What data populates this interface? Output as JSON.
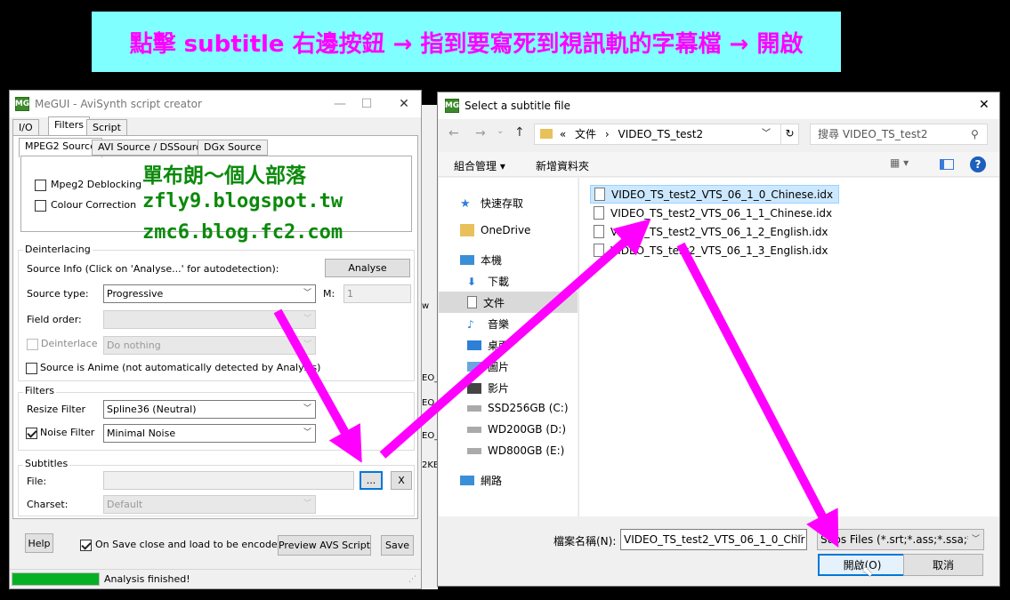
{
  "banner": {
    "text": "點擊 subtitle 右邊按鈕 → 指到要寫死到視訊軌的字幕檔 → 開啟"
  },
  "megui": {
    "title": "MeGUI - AviSynth script creator",
    "app_icon": "MG",
    "main_tabs": [
      "I/O",
      "Filters",
      "Script"
    ],
    "sub_tabs": [
      "MPEG2 Source",
      "AVI Source / DSSource",
      "DGx Source"
    ],
    "mpeg2": {
      "deblocking": "Mpeg2 Deblocking",
      "colour_correction": "Colour Correction"
    },
    "deinterlacing": {
      "legend": "Deinterlacing",
      "source_info": "Source Info (Click on 'Analyse...' for autodetection):",
      "analyse_button": "Analyse",
      "source_type_label": "Source type:",
      "source_type_value": "Progressive",
      "m_label": "M:",
      "m_value": "1",
      "field_order_label": "Field order:",
      "field_order_value": "",
      "deinterlace_label": "Deinterlace",
      "deinterlace_value": "Do nothing",
      "source_anime": "Source is Anime (not automatically detected by Analysis)"
    },
    "filters": {
      "legend": "Filters",
      "resize_label": "Resize Filter",
      "resize_value": "Spline36 (Neutral)",
      "noise_label": "Noise Filter",
      "noise_value": "Minimal Noise"
    },
    "subtitles": {
      "legend": "Subtitles",
      "file_label": "File:",
      "file_value": "",
      "browse_button": "...",
      "clear_button": "X",
      "charset_label": "Charset:",
      "charset_value": "Default"
    },
    "bottom": {
      "help_button": "Help",
      "on_save": "On Save close and load to be encoded",
      "preview_button": "Preview AVS Script",
      "save_button": "Save"
    },
    "status": {
      "text": "Analysis finished!",
      "progress": 1.0
    }
  },
  "watermark": {
    "line1": "單布朗～個人部落",
    "line2": "zfly9.blogspot.tw",
    "line3": "zmc6.blog.fc2.com"
  },
  "background_window": {
    "fragments": [
      "w",
      "EO_",
      "EO_",
      "2KB",
      "EO_"
    ]
  },
  "dialog": {
    "title": "Select a subtitle file",
    "address": {
      "prefix": "«",
      "parts": [
        "文件",
        "VIDEO_TS_test2"
      ]
    },
    "search_placeholder": "搜尋 VIDEO_TS_test2",
    "organize": "組合管理 ▾",
    "new_folder": "新增資料夾",
    "nav": [
      {
        "label": "快速存取",
        "icon": "quick-access-icon"
      },
      {
        "label": "OneDrive",
        "icon": "onedrive-icon"
      },
      {
        "label": "本機",
        "icon": "this-pc-icon"
      },
      {
        "label": "下載",
        "icon": "downloads-icon"
      },
      {
        "label": "文件",
        "icon": "documents-icon"
      },
      {
        "label": "音樂",
        "icon": "music-icon"
      },
      {
        "label": "桌面",
        "icon": "desktop-icon"
      },
      {
        "label": "圖片",
        "icon": "pictures-icon"
      },
      {
        "label": "影片",
        "icon": "videos-icon"
      },
      {
        "label": "SSD256GB (C:)",
        "icon": "drive-icon"
      },
      {
        "label": "WD200GB (D:)",
        "icon": "drive-icon"
      },
      {
        "label": "WD800GB (E:)",
        "icon": "drive-icon"
      },
      {
        "label": "網路",
        "icon": "network-icon"
      }
    ],
    "files": [
      "VIDEO_TS_test2_VTS_06_1_0_Chinese.idx",
      "VIDEO_TS_test2_VTS_06_1_1_Chinese.idx",
      "VIDEO_TS_test2_VTS_06_1_2_English.idx",
      "VIDEO_TS_test2_VTS_06_1_3_English.idx"
    ],
    "filename_label": "檔案名稱(N):",
    "filename_value": "VIDEO_TS_test2_VTS_06_1_0_Chir",
    "filter_value": "Subs Files (*.srt;*.ass;*.ssa;*.idx",
    "open_button": "開啟(O)",
    "cancel_button": "取消"
  },
  "colors": {
    "banner_bg": "#7fffff",
    "banner_text": "#ff00ff",
    "arrow": "#ff00ff",
    "watermark": "#0b8a0b",
    "progress": "#06b025"
  }
}
